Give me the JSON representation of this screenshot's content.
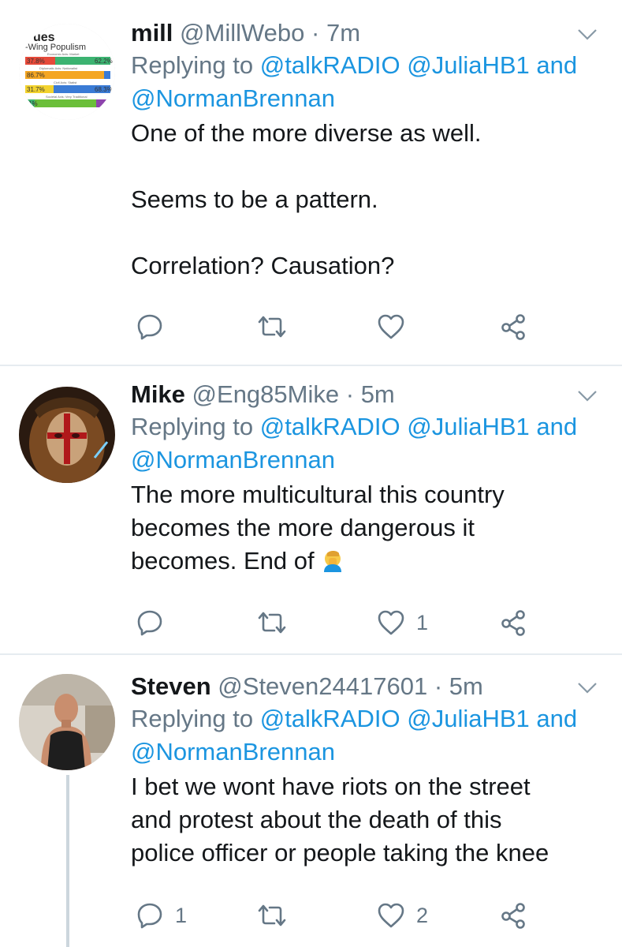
{
  "tweets": [
    {
      "name": "mill",
      "handle": "@MillWebo",
      "time": "7m",
      "replying_prefix": "Replying to",
      "mention1": "@talkRADIO",
      "mention2": "@JuliaHB1",
      "and_word": "and",
      "mention3": "@NormanBrennan",
      "text_lines": [
        "One of the more diverse as well.",
        "Seems to be a pattern.",
        "Correlation? Causation?"
      ],
      "reply_count": "",
      "retweet_count": "",
      "like_count": "",
      "avatar_image_text": {
        "title": "ues",
        "subtitle": "-Wing Populism",
        "axis1": "Economic Axis: Market",
        "v1a": "37.8%",
        "v1b": "62.2%",
        "axis2": "Diplomatic Axis: Nationalist",
        "v2": "86.7%",
        "axis3": "Civil Axis: Statist",
        "v3a": "31.7%",
        "v3b": "68.3%",
        "axis4": "Societal Axis: Very Traditional",
        "v4": "1%"
      }
    },
    {
      "name": "Mike",
      "handle": "@Eng85Mike",
      "time": "5m",
      "replying_prefix": "Replying to",
      "mention1": "@talkRADIO",
      "mention2": "@JuliaHB1",
      "and_word": "and",
      "mention3": "@NormanBrennan",
      "text_lines": [
        "The more multicultural this country",
        "becomes the more dangerous it",
        "becomes. End of"
      ],
      "reply_count": "",
      "retweet_count": "",
      "like_count": "1"
    },
    {
      "name": "Steven",
      "handle": "@Steven24417601",
      "time": "5m",
      "replying_prefix": "Replying to",
      "mention1": "@talkRADIO",
      "mention2": "@JuliaHB1",
      "and_word": "and",
      "mention3": "@NormanBrennan",
      "text_lines": [
        "I bet we wont have riots on the street",
        "and protest about the death of this",
        "police officer or people taking the knee"
      ],
      "reply_count": "1",
      "retweet_count": "",
      "like_count": "2"
    }
  ],
  "separator": "·",
  "icons": {
    "reply": "reply-icon",
    "retweet": "retweet-icon",
    "like": "heart-icon",
    "share": "share-icon",
    "caret": "chevron-down-icon",
    "emoji": "face-palm-emoji"
  },
  "colors": {
    "link": "#1b95e0",
    "secondary_text": "#657786",
    "primary_text": "#14171a",
    "divider": "#e6ecf0"
  }
}
